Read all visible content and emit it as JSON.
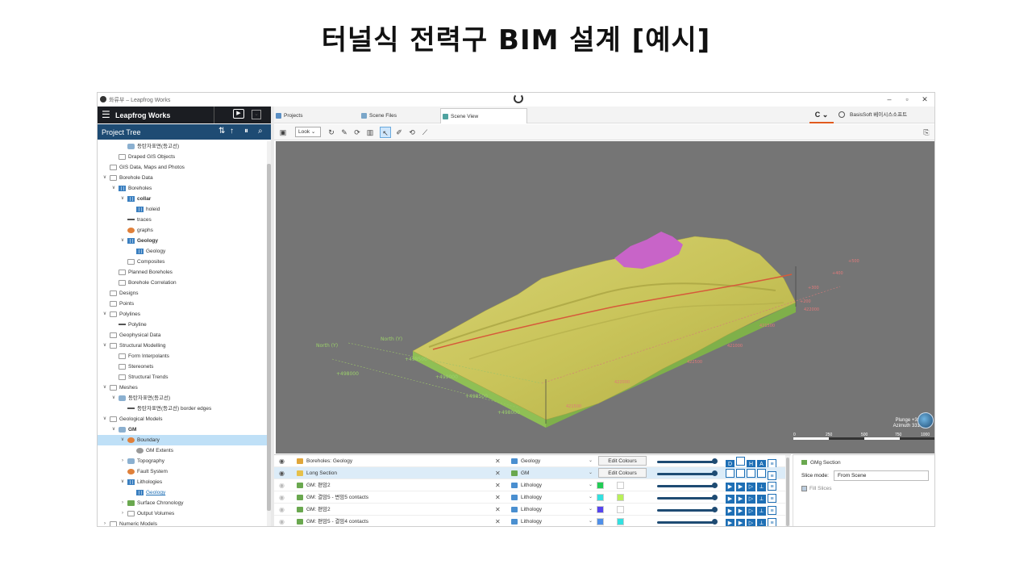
{
  "slide": {
    "title": "터널식 전력구 BIM 설계 [예시]"
  },
  "window": {
    "title": "Leapfrog Works",
    "title_prefix": "화류부 – ",
    "minimize": "–",
    "maximize": "▫",
    "close": "✕"
  },
  "brand": {
    "name": "Leapfrog Works",
    "hamburger": "☰",
    "play": "▶",
    "collapse": "⌄"
  },
  "project_tree": {
    "title": "Project Tree",
    "items": [
      {
        "label": "등탄자표면(등고선)",
        "indent": 3,
        "chev": "",
        "icon": "mesh"
      },
      {
        "label": "Draped GIS Objects",
        "indent": 2,
        "chev": "",
        "icon": "folder"
      },
      {
        "label": "GIS Data, Maps and Photos",
        "indent": 1,
        "chev": "",
        "icon": "folder"
      },
      {
        "label": "Borehole Data",
        "indent": 1,
        "chev": "∨",
        "icon": "folder"
      },
      {
        "label": "Boreholes",
        "indent": 2,
        "chev": "∨",
        "icon": "grid"
      },
      {
        "label": "collar",
        "indent": 3,
        "chev": "∨",
        "icon": "grid",
        "bold": true
      },
      {
        "label": "holeid",
        "indent": 4,
        "chev": "",
        "icon": "grid"
      },
      {
        "label": "traces",
        "indent": 3,
        "chev": "",
        "icon": "line"
      },
      {
        "label": "graphs",
        "indent": 3,
        "chev": "",
        "icon": "gm"
      },
      {
        "label": "Geology",
        "indent": 3,
        "chev": "∨",
        "icon": "grid",
        "bold": true
      },
      {
        "label": "Geology",
        "indent": 4,
        "chev": "",
        "icon": "grid"
      },
      {
        "label": "Composites",
        "indent": 3,
        "chev": "",
        "icon": "folder"
      },
      {
        "label": "Planned Boreholes",
        "indent": 2,
        "chev": "",
        "icon": "folder"
      },
      {
        "label": "Borehole Correlation",
        "indent": 2,
        "chev": "",
        "icon": "folder"
      },
      {
        "label": "Designs",
        "indent": 1,
        "chev": "",
        "icon": "folder"
      },
      {
        "label": "Points",
        "indent": 1,
        "chev": "",
        "icon": "folder"
      },
      {
        "label": "Polylines",
        "indent": 1,
        "chev": "∨",
        "icon": "folder"
      },
      {
        "label": "Polyline",
        "indent": 2,
        "chev": "",
        "icon": "line"
      },
      {
        "label": "Geophysical Data",
        "indent": 1,
        "chev": "",
        "icon": "folder"
      },
      {
        "label": "Structural Modelling",
        "indent": 1,
        "chev": "∨",
        "icon": "folder"
      },
      {
        "label": "Form Interpolants",
        "indent": 2,
        "chev": "",
        "icon": "folder"
      },
      {
        "label": "Stereonets",
        "indent": 2,
        "chev": "",
        "icon": "folder"
      },
      {
        "label": "Structural Trends",
        "indent": 2,
        "chev": "",
        "icon": "folder"
      },
      {
        "label": "Meshes",
        "indent": 1,
        "chev": "∨",
        "icon": "folder"
      },
      {
        "label": "등탄자표면(등고선)",
        "indent": 2,
        "chev": "∨",
        "icon": "mesh"
      },
      {
        "label": "등탄자표면(등고선) border edges",
        "indent": 3,
        "chev": "",
        "icon": "line"
      },
      {
        "label": "Geological Models",
        "indent": 1,
        "chev": "∨",
        "icon": "folder"
      },
      {
        "label": "GM",
        "indent": 2,
        "chev": "∨",
        "icon": "mesh",
        "bold": true
      },
      {
        "label": "Boundary",
        "indent": 3,
        "chev": "∨",
        "icon": "gm",
        "selected": true
      },
      {
        "label": "GM Extents",
        "indent": 4,
        "chev": "",
        "icon": "sphere"
      },
      {
        "label": "Topography",
        "indent": 3,
        "chev": "›",
        "icon": "mesh"
      },
      {
        "label": "Fault System",
        "indent": 3,
        "chev": "",
        "icon": "gm"
      },
      {
        "label": "Lithologies",
        "indent": 3,
        "chev": "∨",
        "icon": "grid"
      },
      {
        "label": "Geology",
        "indent": 4,
        "chev": "",
        "icon": "grid",
        "link": true
      },
      {
        "label": "Surface Chronology",
        "indent": 3,
        "chev": "›",
        "icon": "geo"
      },
      {
        "label": "Output Volumes",
        "indent": 3,
        "chev": "›",
        "icon": "folder"
      },
      {
        "label": "Numeric Models",
        "indent": 1,
        "chev": "›",
        "icon": "folder"
      }
    ]
  },
  "tabs": [
    {
      "label": "Projects",
      "active": false,
      "color": "#5a8fc4"
    },
    {
      "label": "Scene Files",
      "active": false,
      "color": "#7aa6c9"
    },
    {
      "label": "Scene View",
      "active": true,
      "color": "#4fa3a0"
    }
  ],
  "header_right": {
    "c_button": "C ⌄",
    "user": "BasisSoft 베이시스소프트"
  },
  "scene_toolbar": {
    "look": "Look ⌄"
  },
  "viewport": {
    "labels": {
      "north1": "North (Y)",
      "north2": "North (Y)",
      "ax1": "+498000",
      "ax2": "+498500",
      "ax3": "+499000",
      "ax4": "+498500",
      "ax5": "+498000",
      "east1": "421500",
      "east2": "422000",
      "east3": "422500",
      "east4": "421000",
      "east5": "421500",
      "east6": "422000",
      "lvl1": "+200",
      "lvl2": "+300",
      "lvl3": "+400",
      "lvl4": "+500"
    },
    "orientation": {
      "plunge": "Plunge +38",
      "azimuth": "Azimuth 331"
    },
    "scale": {
      "s0": "0",
      "s1": "250",
      "s2": "500",
      "s3": "750",
      "s4": "1000"
    }
  },
  "shapes": [
    {
      "name": "Boreholes: Geology",
      "icon": "#e0a63a",
      "prop": "Geology",
      "prop_icon": "#4a8fd0",
      "visible": true,
      "edit": "Edit Colours",
      "sw1": "",
      "sw2": "",
      "acts": [
        "D",
        "",
        "H",
        "A",
        "≡"
      ],
      "selected": false
    },
    {
      "name": "Long Section",
      "icon": "#e6c04a",
      "prop": "GM",
      "prop_icon": "#6aa84f",
      "visible": true,
      "edit": "Edit Colours",
      "sw1": "",
      "sw2": "",
      "acts": [
        "",
        "",
        "",
        "",
        "≡"
      ],
      "selected": true
    },
    {
      "name": "GM: 편암2",
      "icon": "#6aa84f",
      "prop": "Lithology",
      "prop_icon": "#4a8fd0",
      "visible": false,
      "edit": "",
      "sw1": "#22cc55",
      "sw2": "#ffffff",
      "acts": [
        "▶",
        "▶",
        "▷",
        "⟂",
        "≡"
      ],
      "selected": false
    },
    {
      "name": "GM: 결암5 - 변암5 contacts",
      "icon": "#6aa84f",
      "prop": "Lithology",
      "prop_icon": "#4a8fd0",
      "visible": false,
      "edit": "",
      "sw1": "#33e0e0",
      "sw2": "#b9f05a",
      "acts": [
        "▶",
        "▶",
        "▷",
        "⟂",
        "≡"
      ],
      "selected": false
    },
    {
      "name": "GM: 편암2",
      "icon": "#6aa84f",
      "prop": "Lithology",
      "prop_icon": "#4a8fd0",
      "visible": false,
      "edit": "",
      "sw1": "#5544ee",
      "sw2": "#ffffff",
      "acts": [
        "▶",
        "▶",
        "▷",
        "⟂",
        "≡"
      ],
      "selected": false
    },
    {
      "name": "GM: 편암5 - 결암4 contacts",
      "icon": "#6aa84f",
      "prop": "Lithology",
      "prop_icon": "#4a8fd0",
      "visible": false,
      "edit": "",
      "sw1": "#4f8fe8",
      "sw2": "#33e0e0",
      "acts": [
        "▶",
        "▶",
        "▷",
        "⟂",
        "≡"
      ],
      "selected": false
    }
  ],
  "properties": {
    "title": "GMg Section",
    "slice_label": "Slice mode:",
    "slice_value": "From Scene",
    "fill": "Fill Slices"
  }
}
